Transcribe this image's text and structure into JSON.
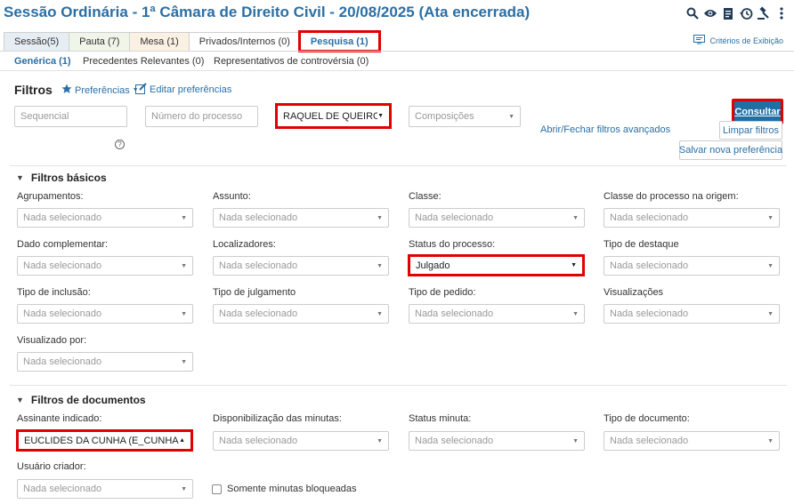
{
  "header": {
    "title": "Sessão Ordinária - 1ª Câmara de Direito Civil - 20/08/2025 (Ata encerrada)",
    "icons": [
      "search-icon",
      "eye-icon",
      "document-icon",
      "history-icon",
      "gavel-icon",
      "more-icon"
    ]
  },
  "tabs": [
    {
      "label": "Sessão(5)"
    },
    {
      "label": "Pauta (7)"
    },
    {
      "label": "Mesa (1)"
    },
    {
      "label": "Privados/Internos (0)"
    },
    {
      "label": "Pesquisa (1)"
    }
  ],
  "criteria_label": "Critérios de Exibição",
  "subtabs": [
    {
      "label": "Genérica (1)"
    },
    {
      "label": "Precedentes Relevantes (0)"
    },
    {
      "label": "Representativos de controvérsia (0)"
    }
  ],
  "filters": {
    "title": "Filtros",
    "preferences_label": "Preferências",
    "edit_preferences_label": "Editar preferências",
    "sequencial_placeholder": "Sequencial",
    "process_number_placeholder": "Número do processo",
    "relator_value": "RAQUEL DE QUEIROZ (C",
    "composicoes_placeholder": "Composições",
    "toggle_advanced": "Abrir/Fechar filtros avançados",
    "consultar": "Consultar",
    "limpar": "Limpar filtros",
    "salvar": "Salvar nova preferência",
    "help": "?"
  },
  "basic": {
    "title": "Filtros básicos",
    "fields": [
      {
        "label": "Agrupamentos:",
        "value": "Nada selecionado"
      },
      {
        "label": "Assunto:",
        "value": "Nada selecionado"
      },
      {
        "label": "Classe:",
        "value": "Nada selecionado"
      },
      {
        "label": "Classe do processo na origem:",
        "value": "Nada selecionado"
      },
      {
        "label": "Dado complementar:",
        "value": "Nada selecionado"
      },
      {
        "label": "Localizadores:",
        "value": "Nada selecionado"
      },
      {
        "label": "Status do processo:",
        "value": "Julgado"
      },
      {
        "label": "Tipo de destaque",
        "value": "Nada selecionado"
      },
      {
        "label": "Tipo de inclusão:",
        "value": "Nada selecionado"
      },
      {
        "label": "Tipo de julgamento",
        "value": "Nada selecionado"
      },
      {
        "label": "Tipo de pedido:",
        "value": "Nada selecionado"
      },
      {
        "label": "Visualizações",
        "value": "Nada selecionado"
      },
      {
        "label": "Visualizado por:",
        "value": "Nada selecionado"
      }
    ]
  },
  "documents": {
    "title": "Filtros de documentos",
    "fields": [
      {
        "label": "Assinante indicado:",
        "value": "EUCLIDES DA CUNHA (E_CUNHA)"
      },
      {
        "label": "Disponibilização das minutas:",
        "value": "Nada selecionado"
      },
      {
        "label": "Status minuta:",
        "value": "Nada selecionado"
      },
      {
        "label": "Tipo de documento:",
        "value": "Nada selecionado"
      },
      {
        "label": "Usuário criador:",
        "value": "Nada selecionado"
      }
    ],
    "checkbox_label": "Somente minutas bloqueadas"
  },
  "colors": {
    "accent": "#2a6fa5",
    "highlight": "#e00000",
    "primary_button": "#1f6fa5"
  }
}
